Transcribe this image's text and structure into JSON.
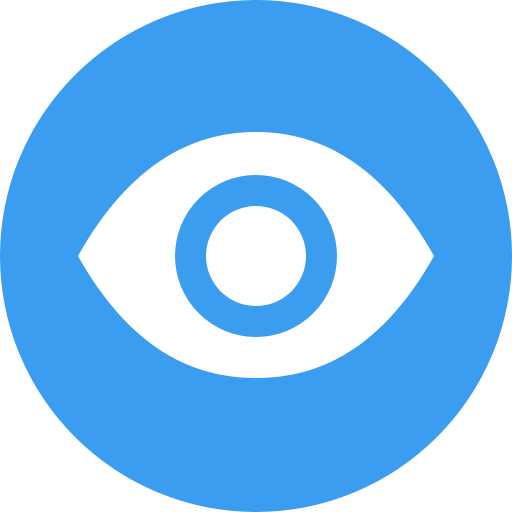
{
  "icon": {
    "name": "eye-icon",
    "colors": {
      "circle": "#3a9df0",
      "eye_white": "#ffffff",
      "iris": "#3a9df0",
      "pupil": "#ffffff"
    }
  }
}
